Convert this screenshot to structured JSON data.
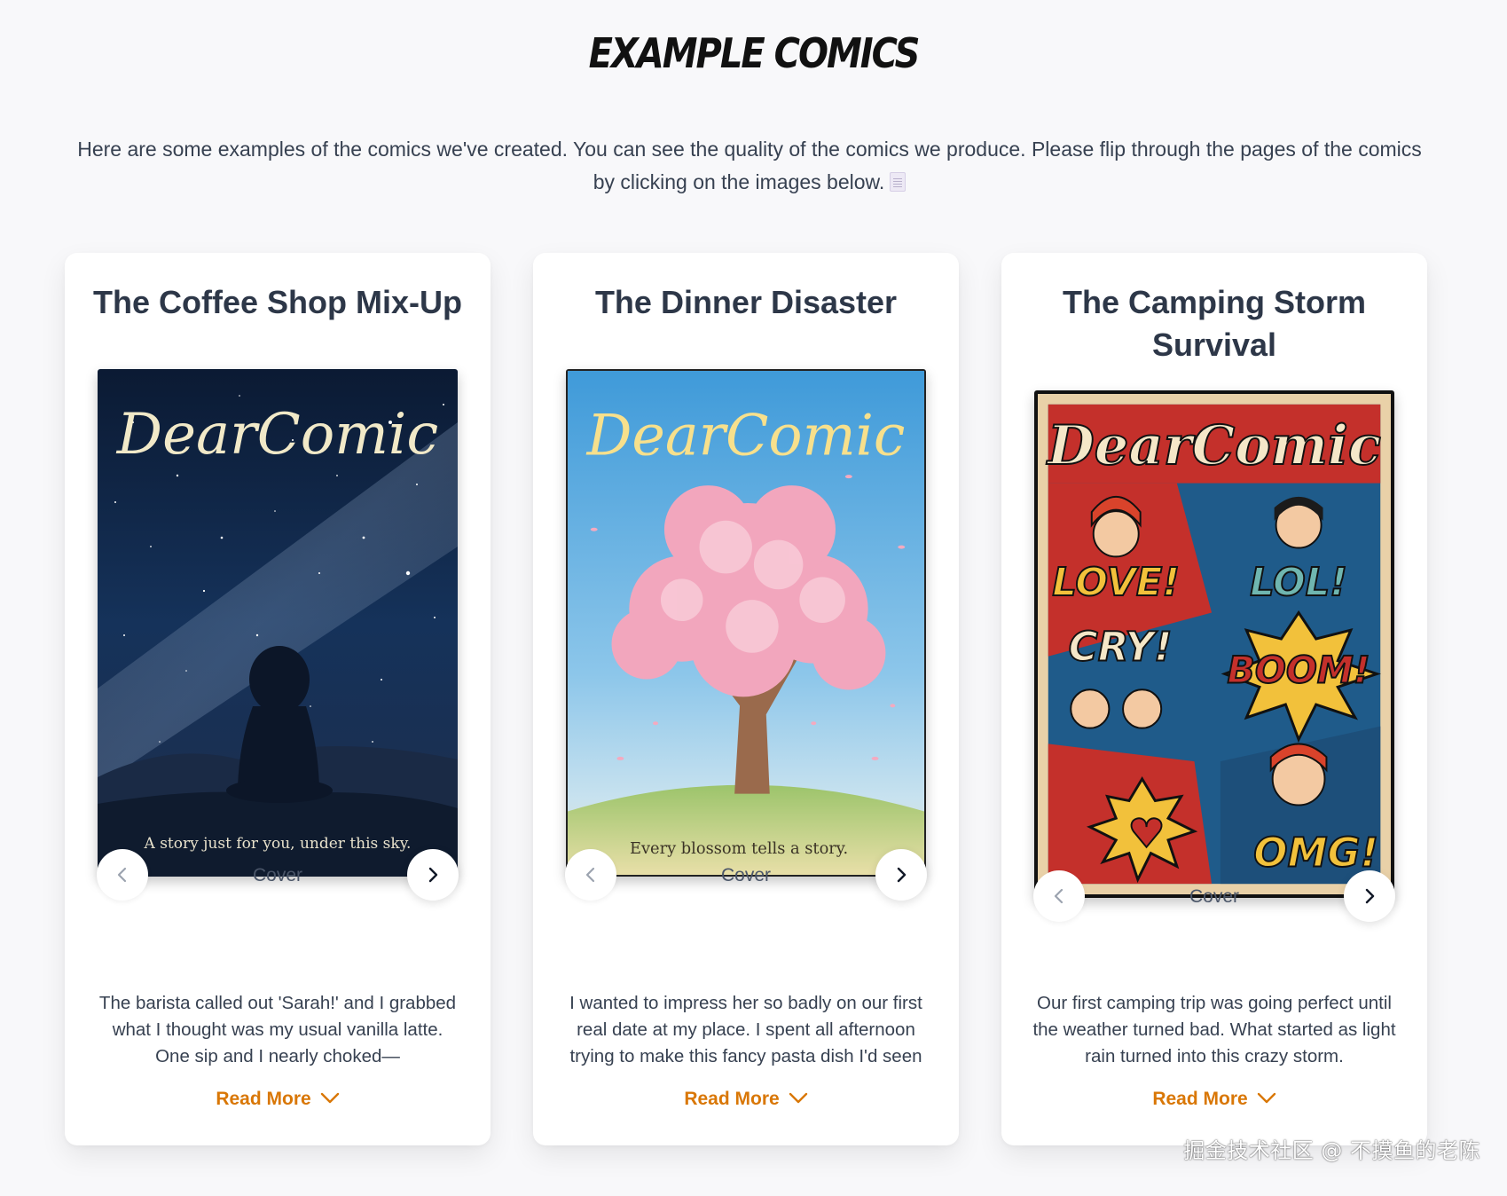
{
  "page": {
    "title": "EXAMPLE COMICS",
    "intro": "Here are some examples of the comics we've created. You can see the quality of the comics we produce. Please flip through the pages of the comics by clicking on the images below.",
    "intro_icon": "document-icon"
  },
  "cards": [
    {
      "title": "The Coffee Shop Mix-Up",
      "cover_brand": "DearComic",
      "cover_tagline": "A story just for you, under this sky.",
      "page_label": "Cover",
      "description": "The barista called out 'Sarah!' and I grabbed what I thought was my usual vanilla latte. One sip and I nearly choked—",
      "read_more": "Read More"
    },
    {
      "title": "The Dinner Disaster",
      "cover_brand": "DearComic",
      "cover_tagline": "Every blossom tells a story.",
      "page_label": "Cover",
      "description": "I wanted to impress her so badly on our first real date at my place. I spent all afternoon trying to make this fancy pasta dish I'd seen",
      "read_more": "Read More"
    },
    {
      "title": "The Camping Storm Survival",
      "cover_brand": "DearComic",
      "cover_words": [
        "LOVE!",
        "LOL!",
        "CRY!",
        "BOOM!",
        "OMG!"
      ],
      "page_label": "Cover",
      "description": "Our first camping trip was going perfect until the weather turned bad. What started as light rain turned into this crazy storm.",
      "read_more": "Read More"
    }
  ],
  "watermark": "掘金技术社区 @ 不摸鱼的老陈",
  "colors": {
    "accent": "#d97706",
    "background": "#f8f8fa",
    "card": "#ffffff",
    "text": "#2d3748"
  }
}
